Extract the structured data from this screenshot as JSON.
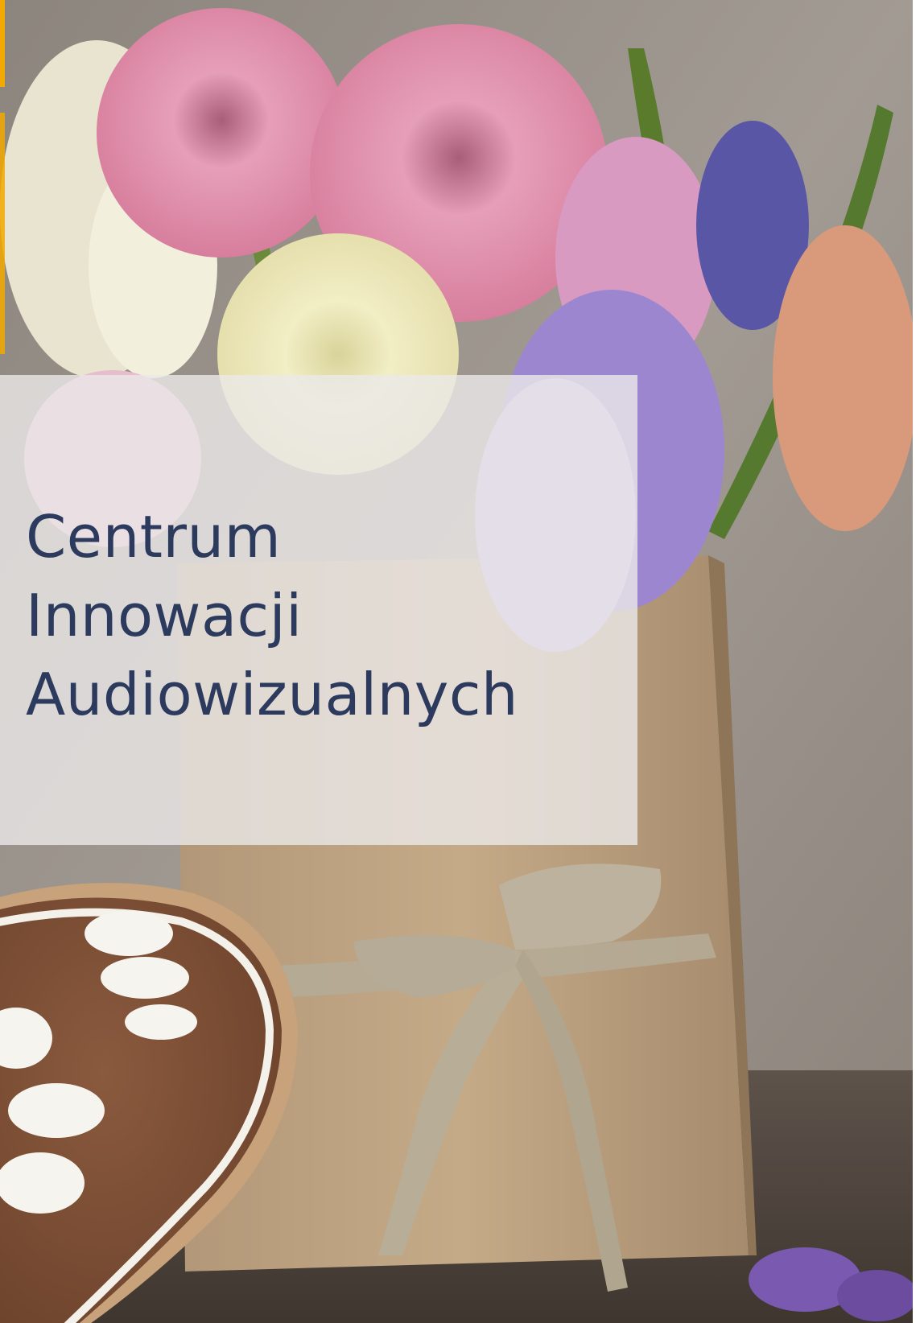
{
  "title": {
    "line1": "Centrum",
    "line2": "Innowacji",
    "line3": "Audiowizualnych"
  },
  "colors": {
    "accent": "#f2a900",
    "title_text": "#2c3a5e",
    "panel": "#ebe9e8",
    "background": "#8a8179"
  },
  "image": {
    "subject": "bouquet of ranunculus and hyacinth flowers in a brown paper bag tied with lace ribbon, next to an iced gingerbread heart"
  }
}
